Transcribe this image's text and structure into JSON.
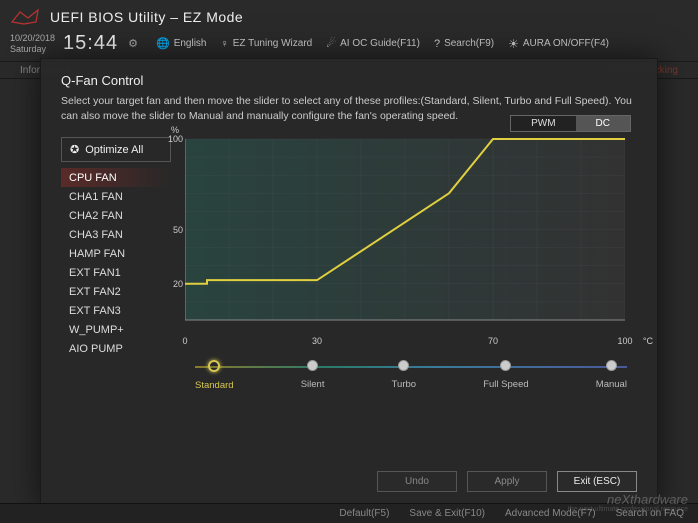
{
  "header": {
    "title": "UEFI BIOS Utility – EZ Mode",
    "date": "10/20/2018",
    "day": "Saturday",
    "time": "15:44",
    "nav": {
      "lang": "English",
      "wizard": "EZ Tuning Wizard",
      "oc": "AI OC Guide(F11)",
      "search": "Search(F9)",
      "aura": "AURA ON/OFF(F4)"
    }
  },
  "tabs": {
    "left": "Information",
    "right": "AI Overclocking"
  },
  "modal": {
    "title": "Q-Fan Control",
    "desc": "Select your target fan and then move the slider to select any of these profiles:(Standard, Silent, Turbo and Full Speed). You can also move the slider to Manual and manually configure the fan's operating speed.",
    "optimize": "Optimize All",
    "fans": [
      "CPU FAN",
      "CHA1 FAN",
      "CHA2 FAN",
      "CHA3 FAN",
      "HAMP FAN",
      "EXT FAN1",
      "EXT FAN2",
      "EXT FAN3",
      "W_PUMP+",
      "AIO PUMP"
    ],
    "selected_fan_index": 0,
    "mode": {
      "pwm": "PWM",
      "dc": "DC",
      "active": "DC"
    },
    "profiles": [
      "Standard",
      "Silent",
      "Turbo",
      "Full Speed",
      "Manual"
    ],
    "active_profile_index": 0,
    "buttons": {
      "undo": "Undo",
      "apply": "Apply",
      "exit": "Exit (ESC)"
    }
  },
  "chart_data": {
    "type": "line",
    "xlabel": "°C",
    "ylabel": "%",
    "xlim": [
      0,
      100
    ],
    "ylim": [
      0,
      100
    ],
    "xticks": [
      0,
      30,
      70,
      100
    ],
    "yticks": [
      20,
      50,
      100
    ],
    "series": [
      {
        "name": "fan-curve",
        "points": [
          [
            0,
            20
          ],
          [
            5,
            20
          ],
          [
            5,
            22
          ],
          [
            30,
            22
          ],
          [
            60,
            70
          ],
          [
            70,
            100
          ],
          [
            100,
            100
          ]
        ],
        "color": "#e0d040"
      }
    ]
  },
  "footer": {
    "default": "Default(F5)",
    "save": "Save & Exit(F10)",
    "adv": "Advanced Mode(F7)",
    "faq": "Search on FAQ"
  },
  "watermark": {
    "brand": "neXthardware",
    "tag": "the next ultimate professional resource"
  }
}
